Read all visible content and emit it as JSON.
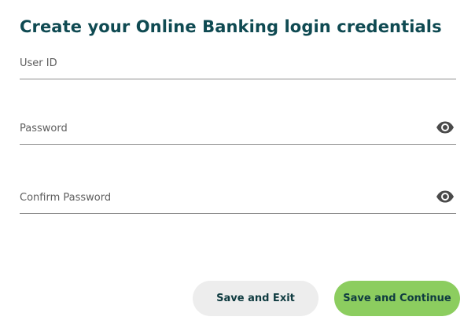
{
  "form": {
    "title": "Create your Online Banking login credentials",
    "fields": {
      "user_id": {
        "placeholder": "User ID",
        "value": ""
      },
      "password": {
        "placeholder": "Password",
        "value": ""
      },
      "confirm_password": {
        "placeholder": "Confirm Password",
        "value": ""
      }
    },
    "icons": {
      "password_toggle": "eye-icon",
      "confirm_toggle": "eye-icon"
    }
  },
  "actions": {
    "save_exit_label": "Save and Exit",
    "save_continue_label": "Save and Continue"
  },
  "colors": {
    "title": "#0f4a52",
    "primary_button": "#8ccd5f",
    "secondary_button": "#ededed",
    "icon": "#4a4a4a"
  }
}
